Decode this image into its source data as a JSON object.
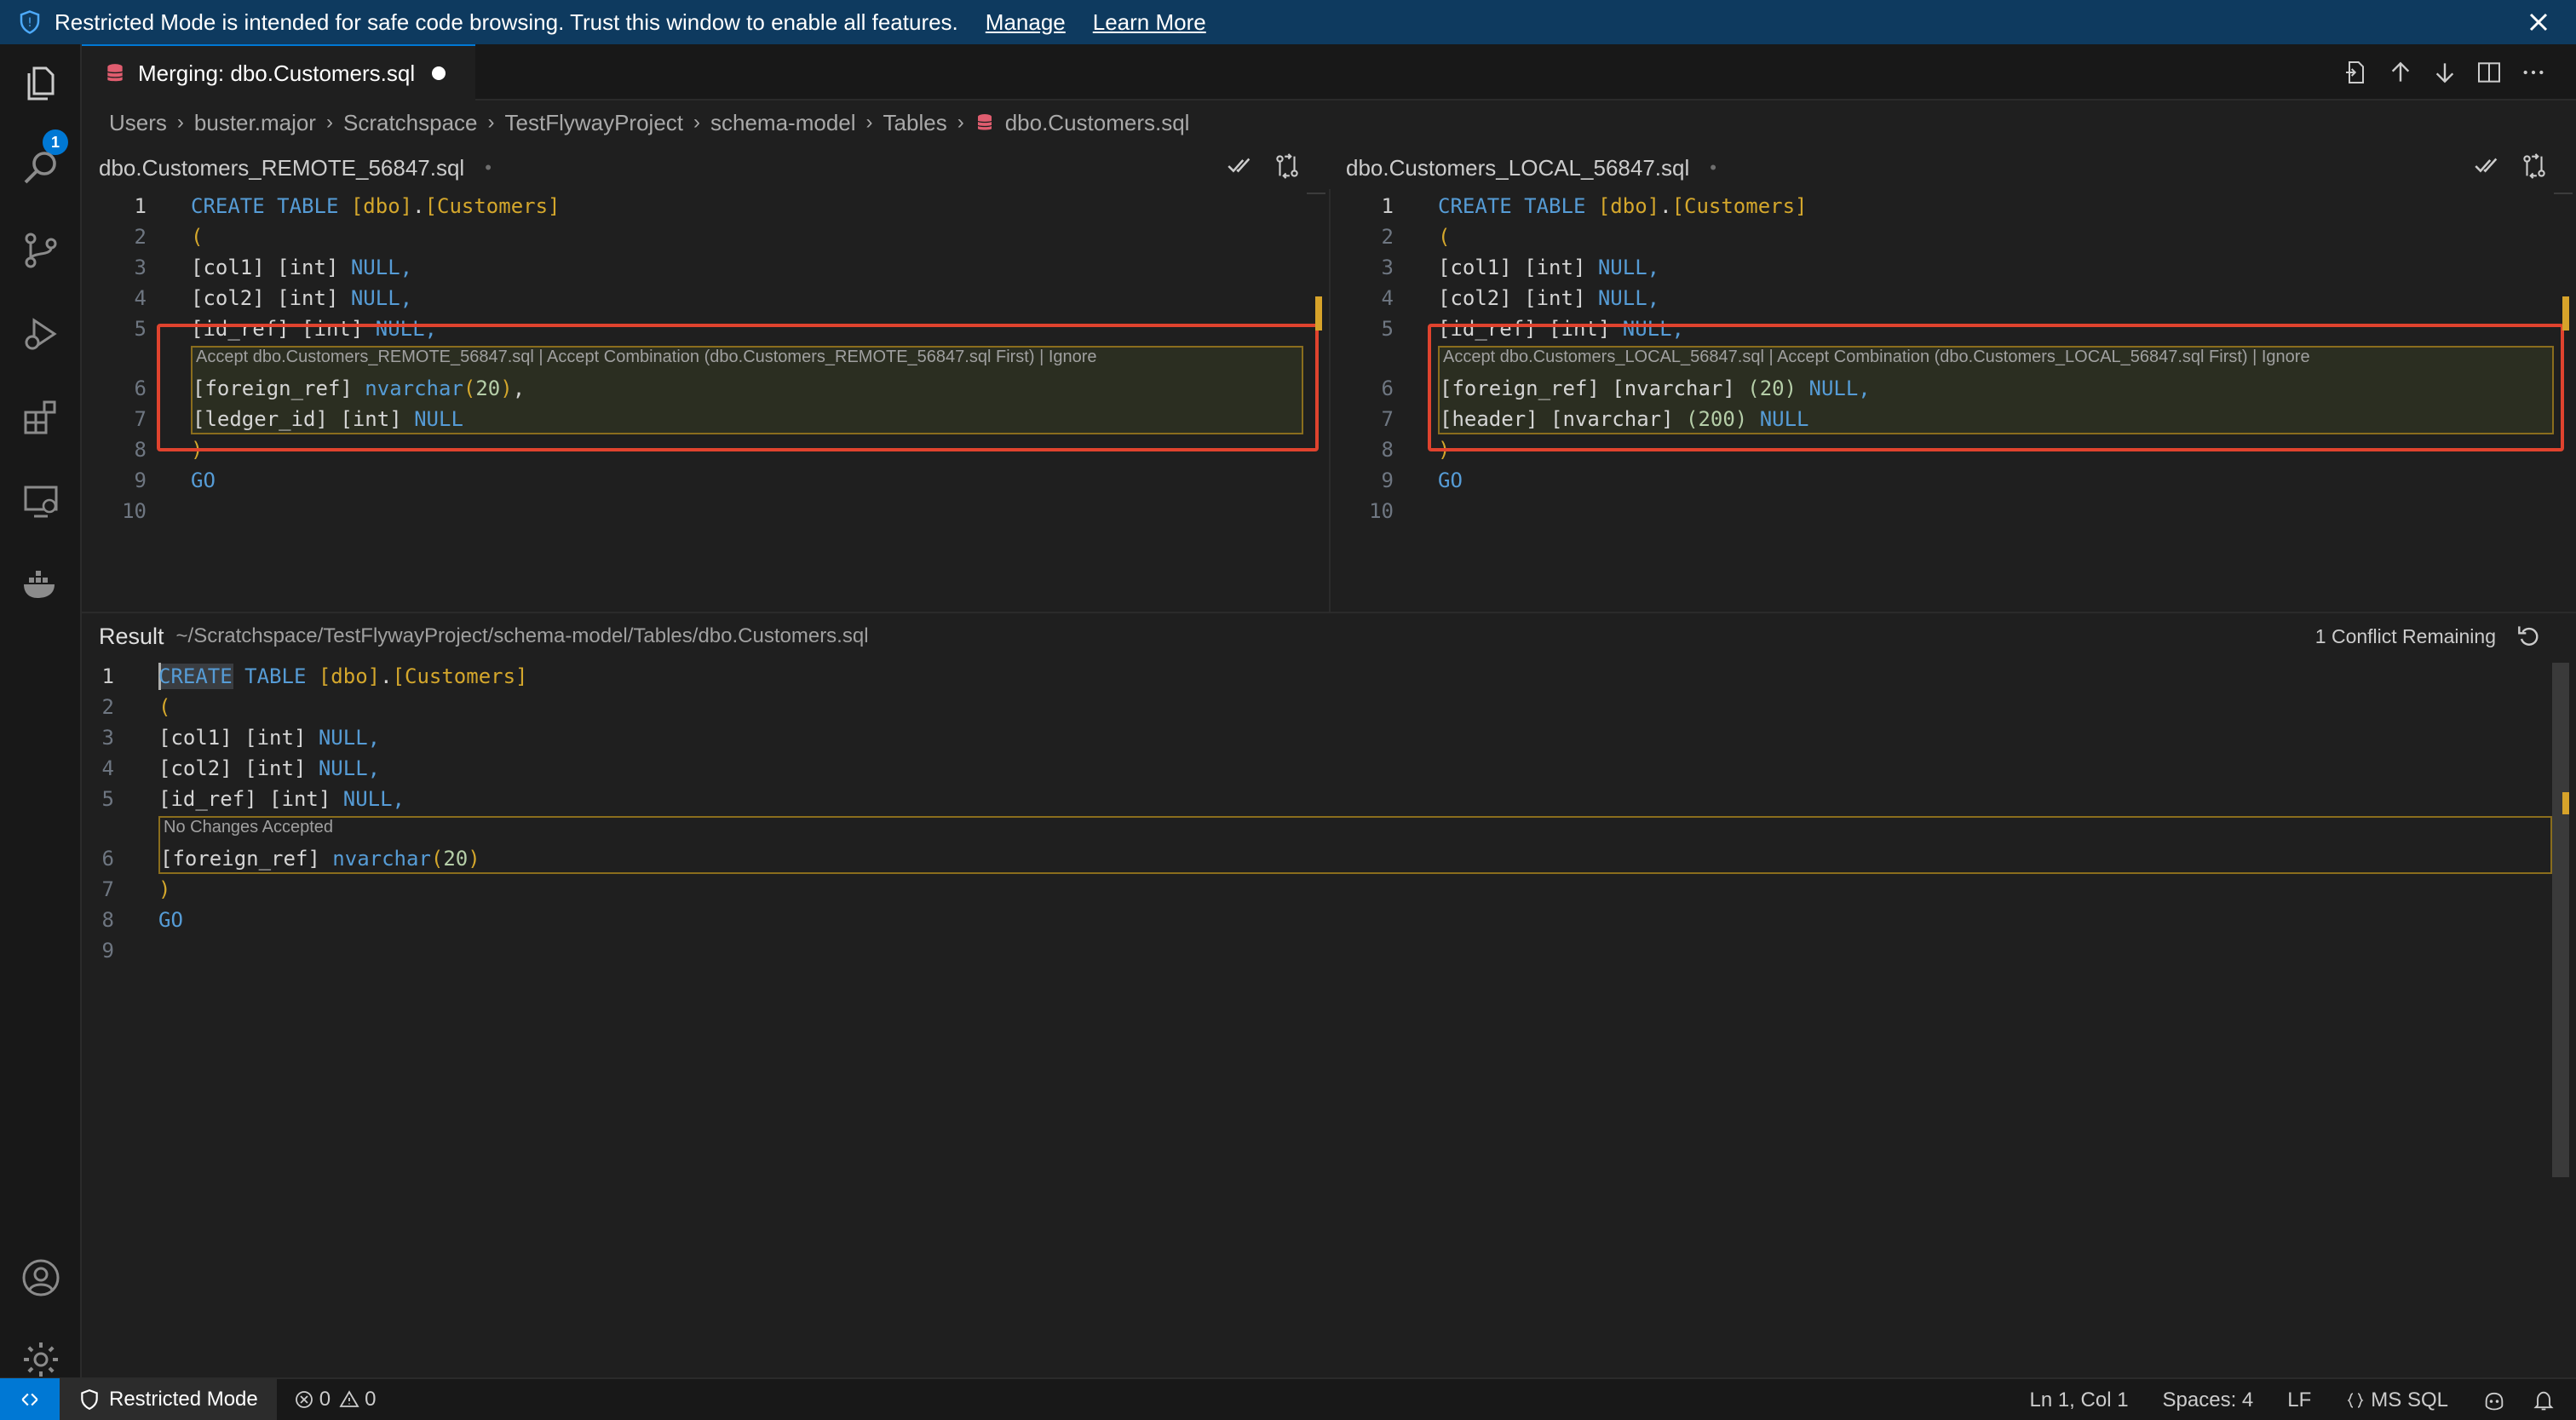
{
  "banner": {
    "message": "Restricted Mode is intended for safe code browsing. Trust this window to enable all features.",
    "manage": "Manage",
    "learn_more": "Learn More"
  },
  "activity": {
    "explorer_badge": "1",
    "icons": [
      "files-icon",
      "search-icon",
      "source-control-icon",
      "run-debug-icon",
      "extensions-icon",
      "remote-explorer-icon",
      "docker-icon",
      "account-icon",
      "settings-gear-icon"
    ]
  },
  "tab": {
    "title": "Merging: dbo.Customers.sql"
  },
  "breadcrumb": [
    "Users",
    "buster.major",
    "Scratchspace",
    "TestFlywayProject",
    "schema-model",
    "Tables",
    "dbo.Customers.sql"
  ],
  "remote_pane": {
    "title": "dbo.Customers_REMOTE_56847.sql",
    "marker": "•",
    "codelens": "Accept dbo.Customers_REMOTE_56847.sql | Accept Combination (dbo.Customers_REMOTE_56847.sql First) | Ignore"
  },
  "local_pane": {
    "title": "dbo.Customers_LOCAL_56847.sql",
    "marker": "•",
    "codelens": "Accept dbo.Customers_LOCAL_56847.sql | Accept Combination (dbo.Customers_LOCAL_56847.sql First) | Ignore"
  },
  "line_numbers": {
    "pane": [
      "1",
      "2",
      "3",
      "4",
      "5",
      "6",
      "7",
      "8",
      "9",
      "10"
    ],
    "result": [
      "1",
      "2",
      "3",
      "4",
      "5",
      "6",
      "7",
      "8",
      "9"
    ]
  },
  "code": {
    "create": "CREATE",
    "table": "TABLE",
    "dbo": "[dbo]",
    "dot": ".",
    "customers": "[Customers]",
    "open_paren": "(",
    "close_paren": ")",
    "go": "GO",
    "col1": "[col1]",
    "col2": "[col2]",
    "id_ref": "[id_ref]",
    "int": "[int]",
    "null": "NULL",
    "null_comma": "NULL,",
    "comma": ",",
    "foreign_ref": "[foreign_ref]",
    "nvarchar": "nvarchar",
    "nvarchar_br": "[nvarchar]",
    "num20": "20",
    "paren20": "(20)",
    "paren200": "(200)",
    "ledger_id": "[ledger_id]",
    "header": "[header]"
  },
  "result": {
    "label": "Result",
    "path": "~/Scratchspace/TestFlywayProject/schema-model/Tables/dbo.Customers.sql",
    "conflicts": "1 Conflict Remaining",
    "codelens": "No Changes Accepted"
  },
  "status": {
    "restricted": "Restricted Mode",
    "errors": "0",
    "warnings": "0",
    "position": "Ln 1, Col 1",
    "spaces": "Spaces: 4",
    "eol": "LF",
    "language": "MS SQL"
  },
  "colors": {
    "accent": "#0078d4",
    "banner_bg": "#0e3a5f",
    "conflict_border": "#8a6d1d",
    "highlight_box": "#e0432e"
  }
}
